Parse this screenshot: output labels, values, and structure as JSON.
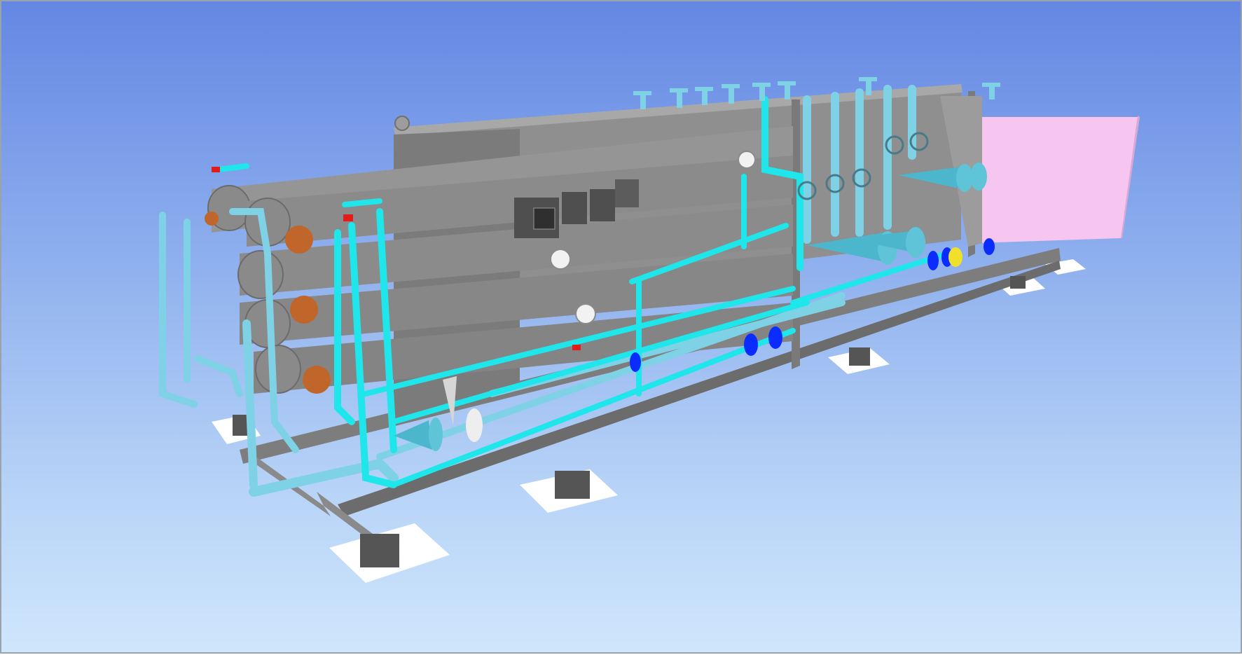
{
  "viewport": {
    "background_top": "#6487e3",
    "background_bottom": "#cfe6fc"
  },
  "model": {
    "colors": {
      "frame": "#7d7d7d",
      "frame_light": "#9a9a9a",
      "vessel": "#8e8e8e",
      "piping_cyan": "#1ee6ea",
      "piping_light_blue": "#7fd2e6",
      "valve_blue": "#0a2cff",
      "tank_pink": "#f6c6f0",
      "gauge_white": "#f2f2f2",
      "end_cap_orange": "#c0662a",
      "pad_white": "#ffffff"
    },
    "components": [
      "steel-skid-frame",
      "pressure-vessel-array",
      "cyan-piping",
      "light-blue-piping",
      "control-panels",
      "pressure-gauges",
      "pump-assemblies",
      "pink-tank",
      "foundation-pads"
    ]
  }
}
